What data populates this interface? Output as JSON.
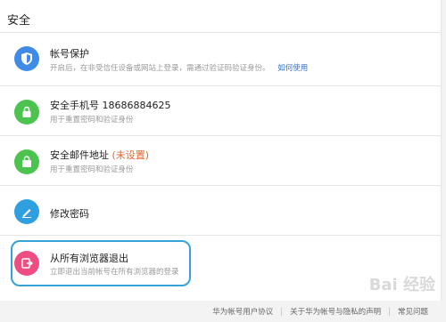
{
  "section": {
    "title": "安全"
  },
  "items": [
    {
      "title": "帐号保护",
      "desc": "开启后，在非受信任设备或网站上登录，需通过验证码验证身份。",
      "link": "如何使用",
      "icon": "shield-icon",
      "color": "#3f8be6"
    },
    {
      "title": "安全手机号 18686884625",
      "desc": "用于重置密码和验证身份",
      "icon": "lock-icon",
      "color": "#4cc34e"
    },
    {
      "title": "安全邮件地址",
      "status": "(未设置)",
      "desc": "用于重置密码和验证身份",
      "icon": "bag-icon",
      "color": "#4cc34e"
    },
    {
      "title": "修改密码",
      "icon": "pencil-icon",
      "color": "#2f9fe0"
    },
    {
      "title": "从所有浏览器退出",
      "desc": "立即退出当前帐号在所有浏览器的登录",
      "icon": "logout-icon",
      "color": "#ee4d82"
    }
  ],
  "footer": {
    "links": [
      "华为帐号用户协议",
      "关于华为帐号与隐私的声明",
      "常见问题"
    ]
  },
  "watermark": "Bai 经验"
}
